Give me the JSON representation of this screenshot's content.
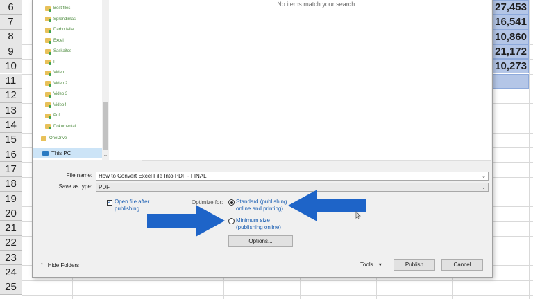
{
  "sheet": {
    "rows": [
      "6",
      "7",
      "8",
      "9",
      "10",
      "11",
      "12",
      "13",
      "14",
      "15",
      "16",
      "17",
      "18",
      "19",
      "20",
      "21",
      "22",
      "23",
      "24",
      "25"
    ],
    "values": [
      "27,453",
      "16,541",
      "10,860",
      "21,172",
      "10,273",
      ""
    ]
  },
  "dialog": {
    "empty_message": "No items match your search.",
    "nav": {
      "folders": [
        "Best files",
        "Sprendimas",
        "Darbo failai",
        "Excel",
        "Saskaitos",
        "IT",
        "Video",
        "Video 2",
        "Video 3",
        "Video4",
        "Pdf",
        "Dokumentai"
      ],
      "onedrive": "OneDrive",
      "this_pc": "This PC"
    },
    "filename": {
      "label": "File name:",
      "value": "How to Convert Excel File Into PDF - FINAL"
    },
    "savetype": {
      "label": "Save as type:",
      "value": "PDF"
    },
    "open_after": {
      "label_line1": "Open file after",
      "label_line2": "publishing",
      "checked": true
    },
    "optimize": {
      "label": "Optimize for:",
      "standard_line1": "Standard (publishing",
      "standard_line2": "online and printing)",
      "minimum_line1": "Minimum size",
      "minimum_line2": "(publishing online)"
    },
    "options_btn": "Options...",
    "hide_folders": "Hide Folders",
    "tools": "Tools",
    "publish": "Publish",
    "cancel": "Cancel"
  },
  "colors": {
    "arrow": "#1e64c8",
    "selection": "#b4c6e7"
  }
}
